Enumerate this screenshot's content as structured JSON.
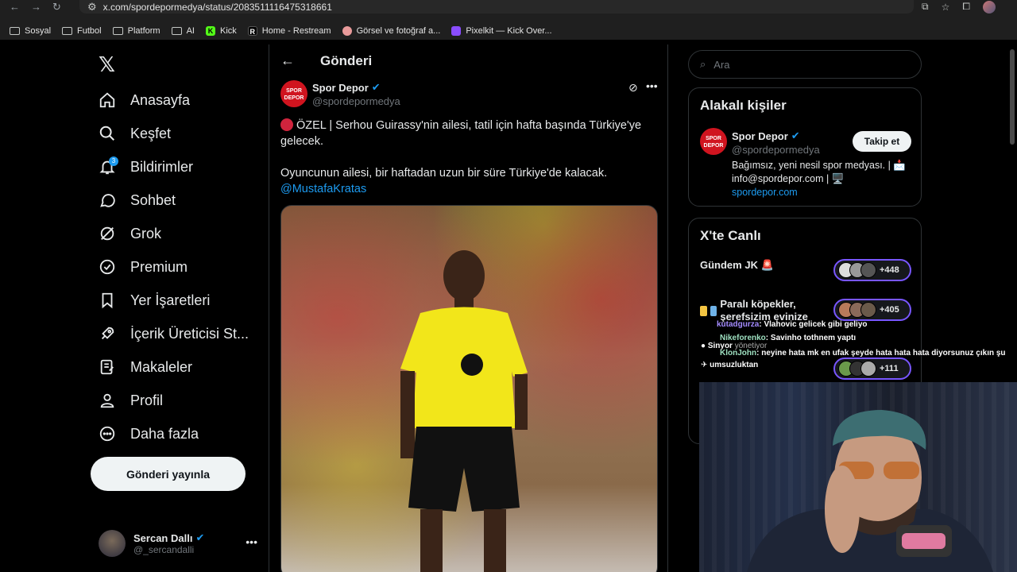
{
  "browser": {
    "url": "x.com/spordepormedya/status/2083511116475318661",
    "bookmarks": [
      {
        "label": "Sosyal",
        "icon": "folder-icon"
      },
      {
        "label": "Futbol",
        "icon": "folder-icon"
      },
      {
        "label": "Platform",
        "icon": "folder-icon"
      },
      {
        "label": "AI",
        "icon": "folder-icon"
      },
      {
        "label": "Kick",
        "icon": "kick-icon"
      },
      {
        "label": "Home - Restream",
        "icon": "restream-icon"
      },
      {
        "label": "Görsel ve fotoğraf a...",
        "icon": "image-site-icon"
      },
      {
        "label": "Pixelkit — Kick Over...",
        "icon": "pixelkit-icon"
      }
    ]
  },
  "nav": {
    "items": [
      {
        "label": "Anasayfa",
        "icon": "home-icon"
      },
      {
        "label": "Keşfet",
        "icon": "search-icon"
      },
      {
        "label": "Bildirimler",
        "icon": "bell-icon",
        "badge": "3"
      },
      {
        "label": "Sohbet",
        "icon": "chat-icon"
      },
      {
        "label": "Grok",
        "icon": "grok-icon"
      },
      {
        "label": "Premium",
        "icon": "premium-icon"
      },
      {
        "label": "Yer İşaretleri",
        "icon": "bookmark-icon"
      },
      {
        "label": "İçerik Üreticisi St...",
        "icon": "rocket-icon"
      },
      {
        "label": "Makaleler",
        "icon": "articles-icon"
      },
      {
        "label": "Profil",
        "icon": "profile-icon"
      },
      {
        "label": "Daha fazla",
        "icon": "more-icon"
      }
    ],
    "post_button": "Gönderi yayınla",
    "user": {
      "name": "Sercan Dallı",
      "handle": "@_sercandalli"
    }
  },
  "center": {
    "title": "Gönderi",
    "tweet": {
      "author": "Spor Depor",
      "handle": "@spordepormedya",
      "avatar_text": "SPOR DEPOR",
      "line1": "ÖZEL | Serhou Guirassy'nin ailesi, tatil için hafta başında Türkiye'ye gelecek.",
      "line2": "Oyuncunun ailesi, bir haftadan uzun bir süre Türkiye'de kalacak.",
      "mention": "@MustafaKratas"
    }
  },
  "right": {
    "search_placeholder": "Ara",
    "related": {
      "title": "Alakalı kişiler",
      "name": "Spor Depor",
      "handle": "@spordepormedya",
      "follow": "Takip et",
      "bio1": "Bağımsız, yeni nesil spor medyası. | 📩",
      "bio2": "info@spordepor.com | 🖥️",
      "link": "spordepor.com"
    },
    "live": {
      "title": "X'te Canlı",
      "rows": [
        {
          "label": "Gündem JK 🚨",
          "count": "+448"
        },
        {
          "label": "Paralı köpekler, şerefsizim evinize",
          "count": "+405"
        },
        {
          "label": "",
          "count": "+111"
        }
      ]
    }
  },
  "chat": [
    {
      "user": "kutadgurza",
      "text": ": Vlahovic gelicek gibi geliyo"
    },
    {
      "user": "Nikeforenko",
      "text": ": Savinho tothnem yaptı"
    },
    {
      "user": "Sinyor",
      "text": "yönetiyor"
    },
    {
      "user": "KlonJohn",
      "text": ": neyine hata mk en ufak şeyde hata hata hata diyorsunuz çıkın şu"
    },
    {
      "user": "",
      "text": "umsuzluktan"
    }
  ]
}
